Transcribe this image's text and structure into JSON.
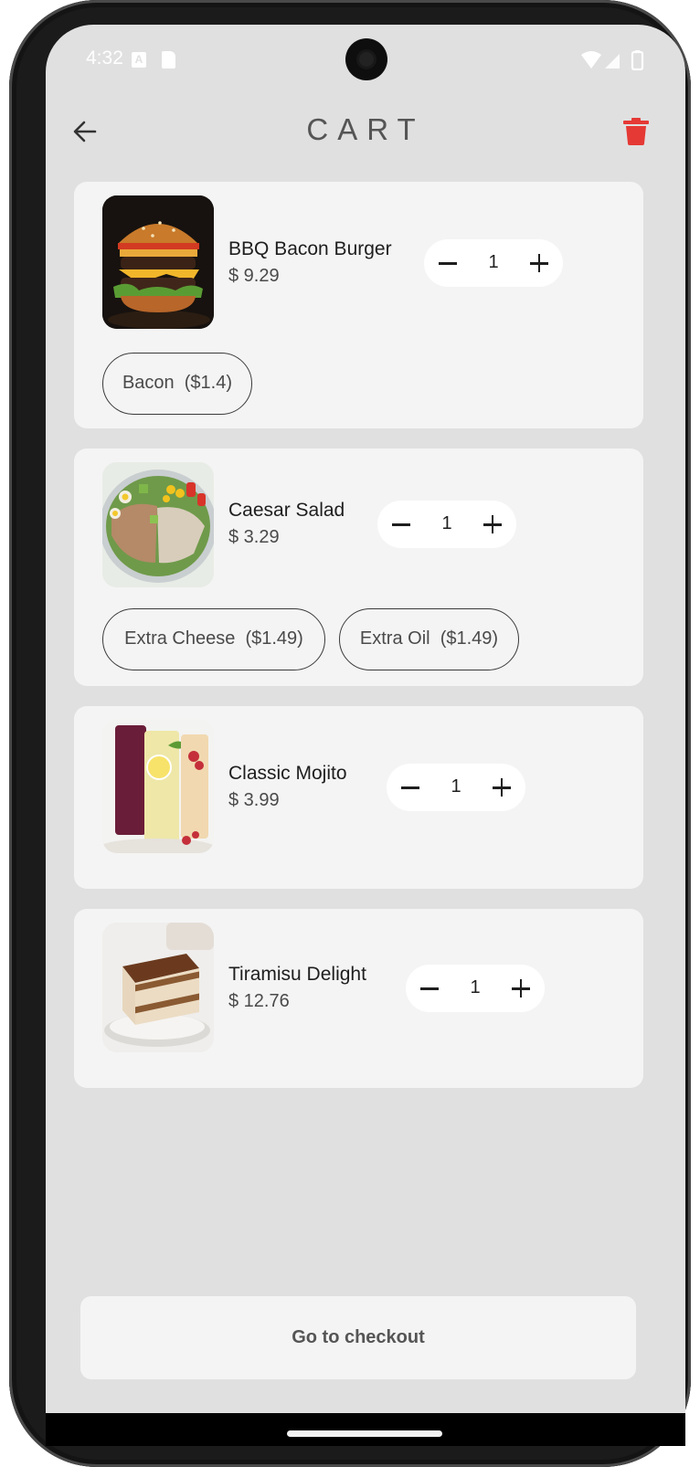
{
  "status_bar": {
    "time": "4:32",
    "keyboard_icon_letter": "A"
  },
  "header": {
    "title": "CART"
  },
  "cart_items": [
    {
      "name": "BBQ Bacon Burger",
      "price": "$ 9.29",
      "quantity": "1",
      "image": "burger-photo",
      "addons": [
        {
          "label": "Bacon  ($1.4)"
        }
      ]
    },
    {
      "name": "Caesar Salad",
      "price": "$ 3.29",
      "quantity": "1",
      "image": "salad-photo",
      "addons": [
        {
          "label": "Extra Cheese  ($1.49)"
        },
        {
          "label": "Extra Oil  ($1.49)"
        }
      ]
    },
    {
      "name": "Classic Mojito",
      "price": "$ 3.99",
      "quantity": "1",
      "image": "mojito-photo",
      "addons": []
    },
    {
      "name": "Tiramisu Delight",
      "price": "$ 12.76",
      "quantity": "1",
      "image": "tiramisu-photo",
      "addons": []
    }
  ],
  "checkout": {
    "label": "Go to checkout"
  },
  "colors": {
    "accent_delete": "#e53935",
    "screen_bg": "#e0e0e0",
    "card_bg": "#f4f4f4"
  }
}
